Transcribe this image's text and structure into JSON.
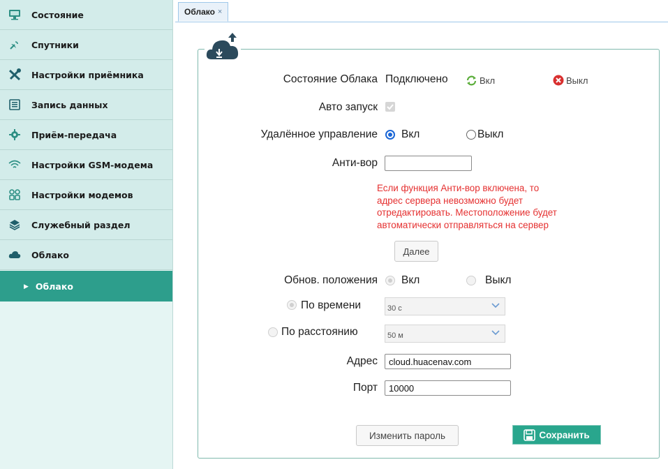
{
  "sidebar": {
    "items": [
      {
        "label": "Состояние",
        "icon": "monitor-icon"
      },
      {
        "label": "Спутники",
        "icon": "satellite-icon"
      },
      {
        "label": "Настройки приёмника",
        "icon": "tools-icon"
      },
      {
        "label": "Запись данных",
        "icon": "log-icon"
      },
      {
        "label": "Приём-передача",
        "icon": "gear-icon"
      },
      {
        "label": "Настройки GSM-модема",
        "icon": "wifi-icon"
      },
      {
        "label": "Настройки модемов",
        "icon": "modules-icon"
      },
      {
        "label": "Служебный раздел",
        "icon": "layers-icon"
      },
      {
        "label": "Облако",
        "icon": "cloud-icon"
      }
    ],
    "sub_item": {
      "label": "Облако"
    }
  },
  "tabs": [
    {
      "label": "Облако",
      "close": "×"
    }
  ],
  "form": {
    "cloud_state": {
      "label": "Состояние Облака",
      "value": "Подключено",
      "on_label": "Вкл",
      "off_label": "Выкл"
    },
    "autostart": {
      "label": "Авто запуск",
      "checked": true
    },
    "remote": {
      "label": "Удалённое управление",
      "on": "Вкл",
      "off": "Выкл",
      "selected": "Вкл"
    },
    "antitheft": {
      "label": "Анти-вор",
      "value": "",
      "warning_lines": [
        "Если функция Анти-вор включена, то",
        "адрес сервера невозможно будет",
        "отредактировать. Местоположение будет",
        "автоматически отправляться на сервер"
      ],
      "next_button": "Далее"
    },
    "position_update": {
      "label": "Обнов. положения",
      "on": "Вкл",
      "off": "Выкл"
    },
    "by_time": {
      "label": "По времени",
      "value": "30 с"
    },
    "by_distance": {
      "label": "По расстоянию",
      "value": "50 м"
    },
    "address": {
      "label": "Адрес",
      "value": "cloud.huacenav.com"
    },
    "port": {
      "label": "Порт",
      "value": "10000"
    },
    "change_password_button": "Изменить пароль",
    "save_button": "Сохранить"
  },
  "colors": {
    "accent": "#29a68d",
    "warning": "#e53030",
    "radio_selected": "#1a66d6",
    "sidebar_bg": "#d3ecea"
  }
}
